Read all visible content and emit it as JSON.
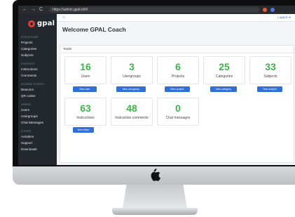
{
  "browser": {
    "url": "https://admin.gpal.nl/#/",
    "back_glyph": "←",
    "forward_glyph": "→",
    "reload_glyph": "C",
    "lock_glyph": "🔒"
  },
  "brand": {
    "name": "gpal",
    "accent": "#e53935"
  },
  "sidebar": {
    "sections": [
      {
        "title": "STRUCTURE",
        "items": [
          "Projects",
          "Categories",
          "Subjects"
        ]
      },
      {
        "title": "CONTENT",
        "items": [
          "Instructions",
          "Comments"
        ]
      },
      {
        "title": "ACCESS POINTS",
        "items": [
          "Beacons",
          "QR codes"
        ]
      },
      {
        "title": "USERS",
        "items": [
          "Users",
          "Usergroups",
          "Chat Messages"
        ]
      },
      {
        "title": "OTHER",
        "items": [
          "Activities",
          "Support",
          "Downloads"
        ]
      }
    ]
  },
  "topbar": {
    "logout": "Logout"
  },
  "page": {
    "title": "Welcome GPAL Coach",
    "panel_title": "Totals"
  },
  "stats": [
    {
      "value": "16",
      "label": "Users",
      "button": "New user"
    },
    {
      "value": "3",
      "label": "Usergroups",
      "button": "New usergroup"
    },
    {
      "value": "6",
      "label": "Projects",
      "button": "New project"
    },
    {
      "value": "25",
      "label": "Categories",
      "button": "New category"
    },
    {
      "value": "33",
      "label": "Subjects",
      "button": "New subject"
    },
    {
      "value": "63",
      "label": "Instructions",
      "button": "New video"
    },
    {
      "value": "48",
      "label": "Instruction comments",
      "button": ""
    },
    {
      "value": "0",
      "label": "Chat messages",
      "button": ""
    }
  ],
  "colors": {
    "stat_number": "#3bb54a",
    "button": "#2f6fd6",
    "sidebar_bg": "#23272e"
  }
}
